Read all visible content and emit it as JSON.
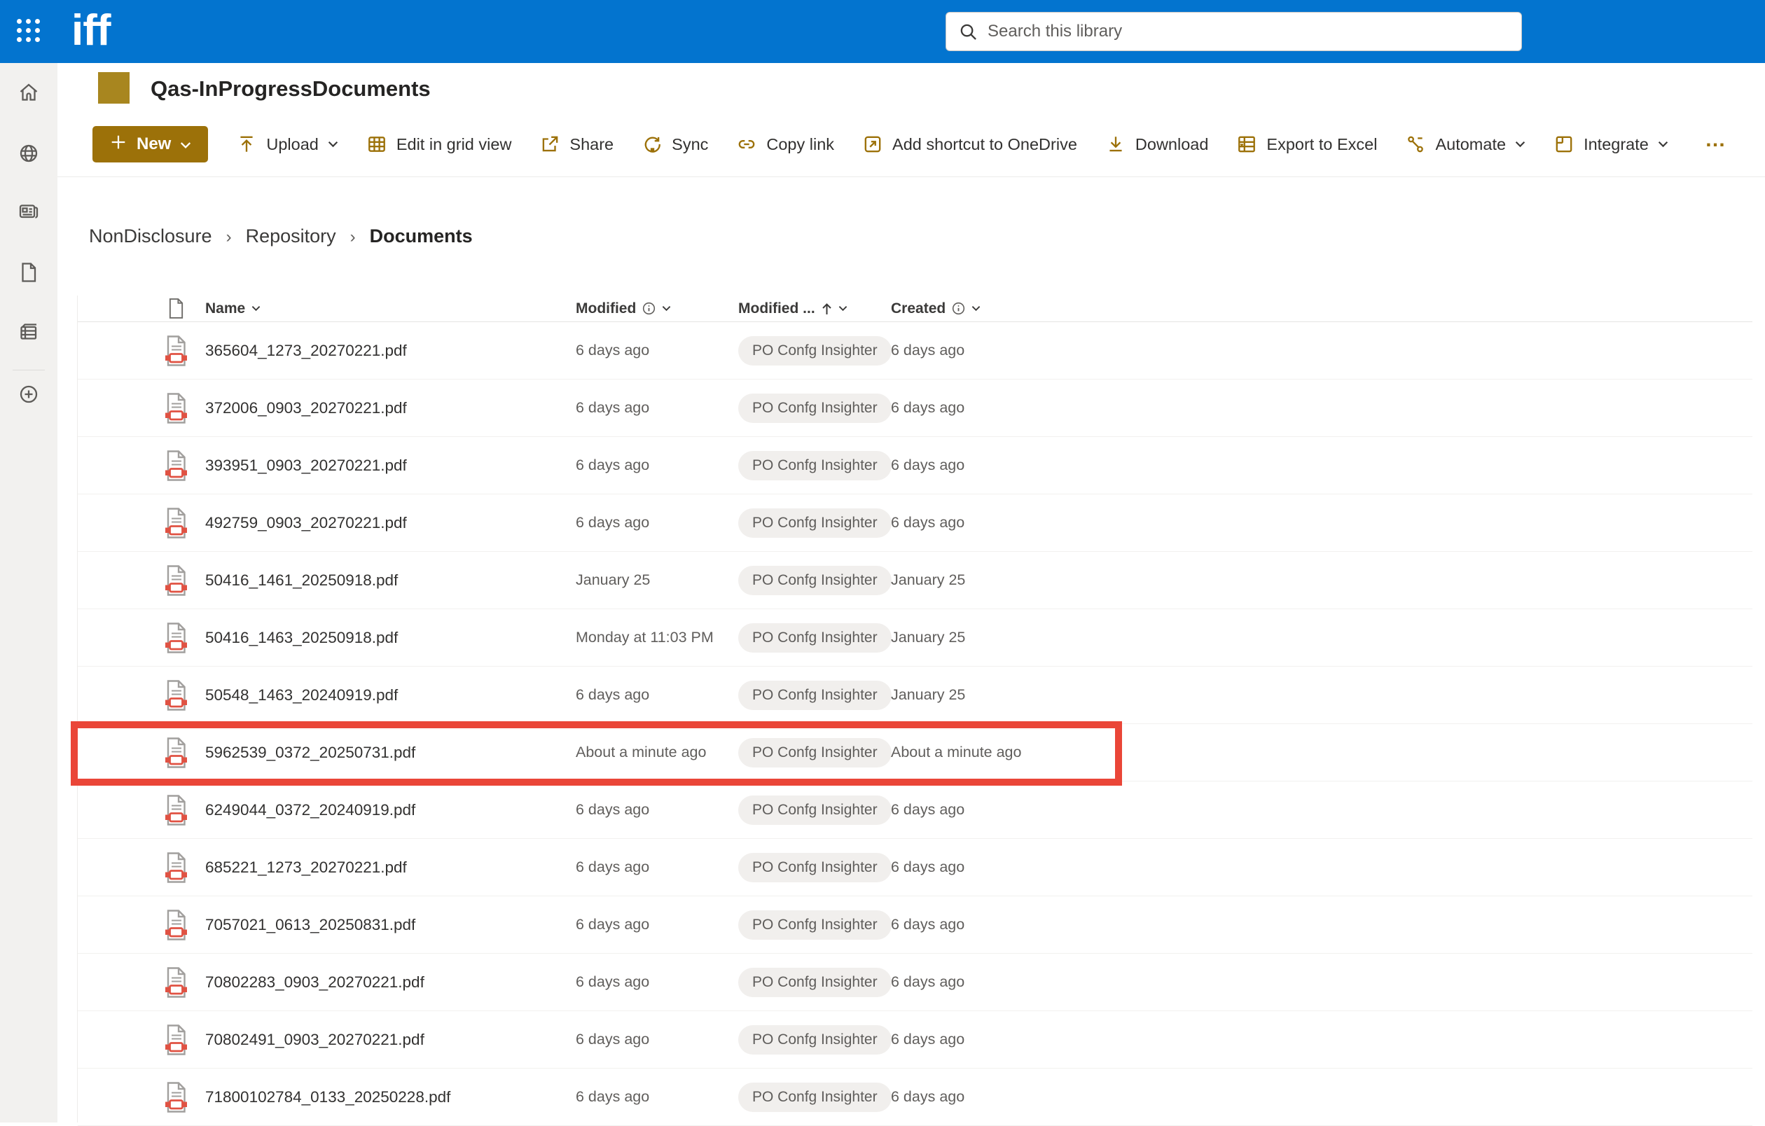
{
  "suite_bar": {
    "logo_text": "iff",
    "search_placeholder": "Search this library"
  },
  "site": {
    "title": "Qas-InProgressDocuments"
  },
  "command_bar": {
    "new_button": {
      "label": "New"
    },
    "items": [
      {
        "label": "Upload",
        "icon": "upload-icon",
        "chevron": true
      },
      {
        "label": "Edit in grid view",
        "icon": "grid-view-icon",
        "chevron": false
      },
      {
        "label": "Share",
        "icon": "share-icon",
        "chevron": false
      },
      {
        "label": "Sync",
        "icon": "sync-icon",
        "chevron": false
      },
      {
        "label": "Copy link",
        "icon": "copy-link-icon",
        "chevron": false
      },
      {
        "label": "Add shortcut to OneDrive",
        "icon": "add-shortcut-icon",
        "chevron": false
      },
      {
        "label": "Download",
        "icon": "download-icon",
        "chevron": false
      },
      {
        "label": "Export to Excel",
        "icon": "export-excel-icon",
        "chevron": false
      },
      {
        "label": "Automate",
        "icon": "automate-icon",
        "chevron": true
      },
      {
        "label": "Integrate",
        "icon": "integrate-icon",
        "chevron": true
      }
    ],
    "overflow_label": "…"
  },
  "breadcrumb": {
    "separator": "›",
    "items": [
      {
        "label": "NonDisclosure",
        "current": false
      },
      {
        "label": "Repository",
        "current": false
      },
      {
        "label": "Documents",
        "current": true
      }
    ]
  },
  "table": {
    "headers": {
      "name": "Name",
      "modified": "Modified",
      "modified_by": "Modified ...",
      "created": "Created"
    },
    "sort_column": "Modified ...",
    "sort_direction": "ascending",
    "rows": [
      {
        "name": "365604_1273_20270221.pdf",
        "modified": "6 days ago",
        "modified_by": "PO Confg Insighter",
        "created": "6 days ago",
        "is_new": false,
        "highlighted": false
      },
      {
        "name": "372006_0903_20270221.pdf",
        "modified": "6 days ago",
        "modified_by": "PO Confg Insighter",
        "created": "6 days ago",
        "is_new": false,
        "highlighted": false
      },
      {
        "name": "393951_0903_20270221.pdf",
        "modified": "6 days ago",
        "modified_by": "PO Confg Insighter",
        "created": "6 days ago",
        "is_new": false,
        "highlighted": false
      },
      {
        "name": "492759_0903_20270221.pdf",
        "modified": "6 days ago",
        "modified_by": "PO Confg Insighter",
        "created": "6 days ago",
        "is_new": false,
        "highlighted": false
      },
      {
        "name": "50416_1461_20250918.pdf",
        "modified": "January 25",
        "modified_by": "PO Confg Insighter",
        "created": "January 25",
        "is_new": false,
        "highlighted": false
      },
      {
        "name": "50416_1463_20250918.pdf",
        "modified": "Monday at 11:03 PM",
        "modified_by": "PO Confg Insighter",
        "created": "January 25",
        "is_new": false,
        "highlighted": false
      },
      {
        "name": "50548_1463_20240919.pdf",
        "modified": "6 days ago",
        "modified_by": "PO Confg Insighter",
        "created": "January 25",
        "is_new": false,
        "highlighted": false
      },
      {
        "name": "5962539_0372_20250731.pdf",
        "modified": "About a minute ago",
        "modified_by": "PO Confg Insighter",
        "created": "About a minute ago",
        "is_new": true,
        "highlighted": true
      },
      {
        "name": "6249044_0372_20240919.pdf",
        "modified": "6 days ago",
        "modified_by": "PO Confg Insighter",
        "created": "6 days ago",
        "is_new": false,
        "highlighted": false
      },
      {
        "name": "685221_1273_20270221.pdf",
        "modified": "6 days ago",
        "modified_by": "PO Confg Insighter",
        "created": "6 days ago",
        "is_new": false,
        "highlighted": false
      },
      {
        "name": "7057021_0613_20250831.pdf",
        "modified": "6 days ago",
        "modified_by": "PO Confg Insighter",
        "created": "6 days ago",
        "is_new": false,
        "highlighted": false
      },
      {
        "name": "70802283_0903_20270221.pdf",
        "modified": "6 days ago",
        "modified_by": "PO Confg Insighter",
        "created": "6 days ago",
        "is_new": false,
        "highlighted": false
      },
      {
        "name": "70802491_0903_20270221.pdf",
        "modified": "6 days ago",
        "modified_by": "PO Confg Insighter",
        "created": "6 days ago",
        "is_new": false,
        "highlighted": false
      },
      {
        "name": "71800102784_0133_20250228.pdf",
        "modified": "6 days ago",
        "modified_by": "PO Confg Insighter",
        "created": "6 days ago",
        "is_new": false,
        "highlighted": false
      }
    ]
  },
  "colors": {
    "suite_bar_blue": "#0374cf",
    "accent_gold": "#9c7109",
    "site_icon_gold": "#a8861f",
    "highlight_red": "#ea4638",
    "pdf_icon_red": "#e05243"
  }
}
